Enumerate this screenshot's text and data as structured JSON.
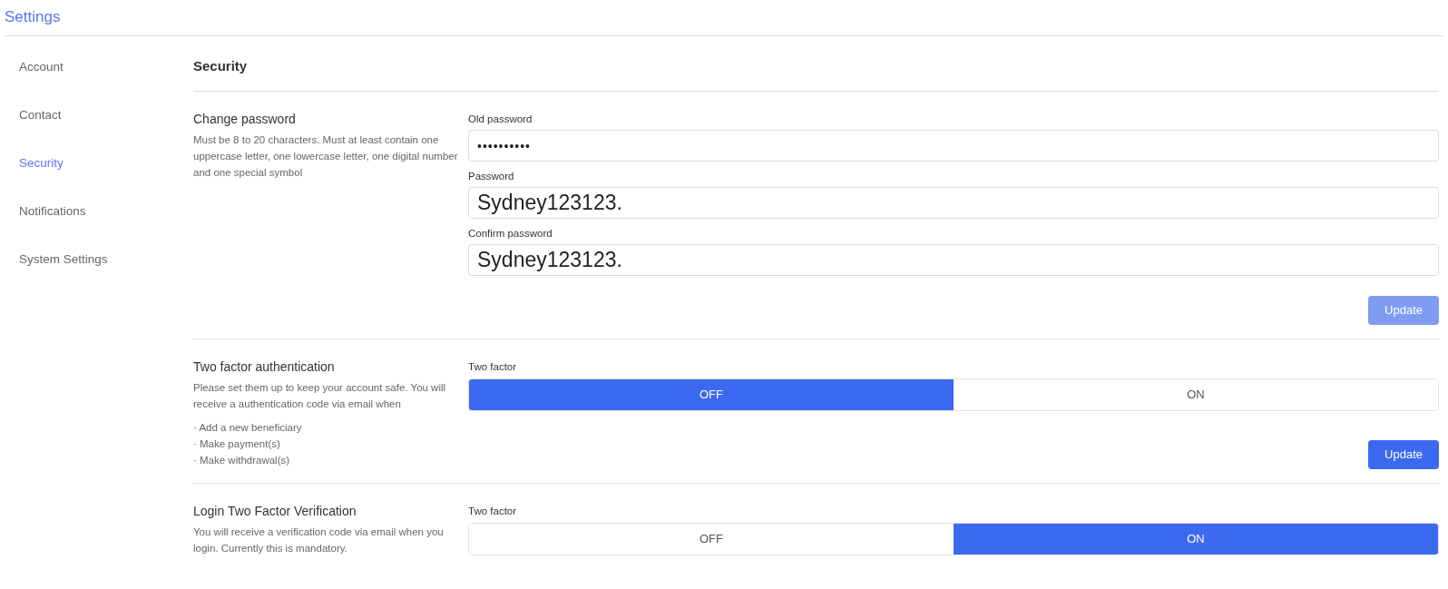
{
  "header": {
    "title": "Settings"
  },
  "sidebar": {
    "items": [
      {
        "label": "Account",
        "selected": false
      },
      {
        "label": "Contact",
        "selected": false
      },
      {
        "label": "Security",
        "selected": true
      },
      {
        "label": "Notifications",
        "selected": false
      },
      {
        "label": "System Settings",
        "selected": false
      }
    ]
  },
  "page_title": "Security",
  "sections": [
    {
      "kind": "password",
      "title": "Change password",
      "description": "Must be 8 to 20 characters. Must at least contain one uppercase letter, one lowercase letter, one digital number and one special symbol",
      "fields": [
        {
          "label": "Old password",
          "value": "••••••••••",
          "masked": true
        },
        {
          "label": "Password",
          "value": "Sydney123123.",
          "masked": false
        },
        {
          "label": "Confirm password",
          "value": "Sydney123123.",
          "masked": false
        }
      ],
      "button": {
        "label": "Update",
        "disabled": true
      }
    },
    {
      "kind": "toggle",
      "title": "Two factor authentication",
      "description": "Please set them up to keep your account safe. You will receive a authentication code via email when",
      "bullets": [
        "· Add a new beneficiary",
        "· Make payment(s)",
        "· Make withdrawal(s)"
      ],
      "toggle_label": "Two factor",
      "options": [
        {
          "label": "OFF",
          "selected": true
        },
        {
          "label": "ON",
          "selected": false
        }
      ],
      "button": {
        "label": "Update",
        "disabled": false
      }
    },
    {
      "kind": "toggle",
      "title": "Login Two Factor Verification",
      "description": "You will receive a verification code via email when you login. Currently this is mandatory.",
      "toggle_label": "Two factor",
      "options": [
        {
          "label": "OFF",
          "selected": false
        },
        {
          "label": "ON",
          "selected": true
        }
      ]
    }
  ]
}
